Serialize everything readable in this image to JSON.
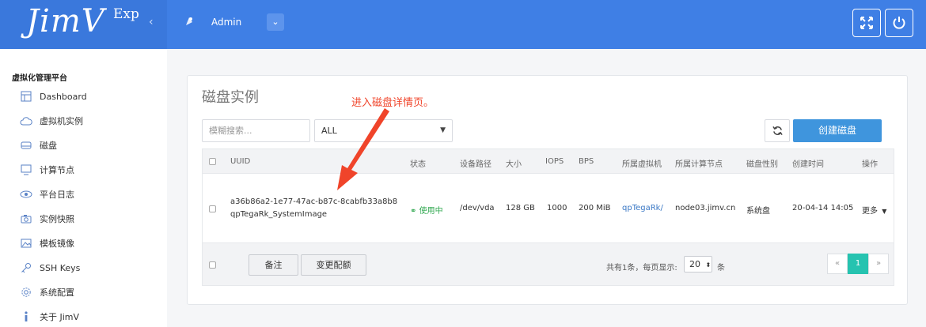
{
  "header": {
    "logo": "JimV",
    "logo_sup": "Exp",
    "user_name": "Admin",
    "collapse_glyph": "‹",
    "user_dropdown_glyph": "⌄",
    "icons": [
      "menu-collapse-icon",
      "user-icon",
      "chevron-down-icon",
      "fullscreen-icon",
      "power-icon"
    ]
  },
  "sidebar": {
    "title": "虚拟化管理平台",
    "items": [
      {
        "label": "Dashboard",
        "icon": "dashboard-icon"
      },
      {
        "label": "虚拟机实例",
        "icon": "cloud-icon"
      },
      {
        "label": "磁盘",
        "icon": "disk-icon"
      },
      {
        "label": "计算节点",
        "icon": "monitor-icon"
      },
      {
        "label": "平台日志",
        "icon": "eye-icon"
      },
      {
        "label": "实例快照",
        "icon": "camera-icon"
      },
      {
        "label": "模板镜像",
        "icon": "image-icon"
      },
      {
        "label": "SSH Keys",
        "icon": "key-icon"
      },
      {
        "label": "系统配置",
        "icon": "gear-icon"
      },
      {
        "label": "关于 JimV",
        "icon": "info-icon"
      }
    ]
  },
  "panel": {
    "title": "磁盘实例",
    "search_placeholder": "模糊搜索...",
    "filter_value": "ALL",
    "create_label": "创建磁盘"
  },
  "table": {
    "columns": [
      "UUID",
      "状态",
      "设备路径",
      "大小",
      "IOPS",
      "BPS",
      "所属虚拟机",
      "所属计算节点",
      "磁盘性别",
      "创建时间",
      "操作"
    ],
    "rows": [
      {
        "uuid": "a36b86a2-1e77-47ac-b87c-8cabfb33a8b8",
        "label": "qpTegaRk_SystemImage",
        "status": "使用中",
        "device": "/dev/vda",
        "size": "128 GB",
        "iops": "1000",
        "bps": "200 MiB",
        "vm": "qpTegaRk/",
        "node": "node03.jimv.cn",
        "disk_type": "系统盘",
        "created": "20-04-14 14:05",
        "action": "更多"
      }
    ]
  },
  "footer": {
    "remark_label": "备注",
    "config_label": "变更配额",
    "total_text": "共有1条，每页显示:",
    "page_size": "20",
    "unit": "条",
    "prev": "«",
    "current_page": "1",
    "next": "»"
  },
  "annotation": "进入磁盘详情页。",
  "colors": {
    "header": "#3f7fe5",
    "primary_button": "#3f95dd",
    "active_page": "#26c3b0",
    "status_ok": "#2fa84f",
    "annotation": "#f0442a"
  }
}
